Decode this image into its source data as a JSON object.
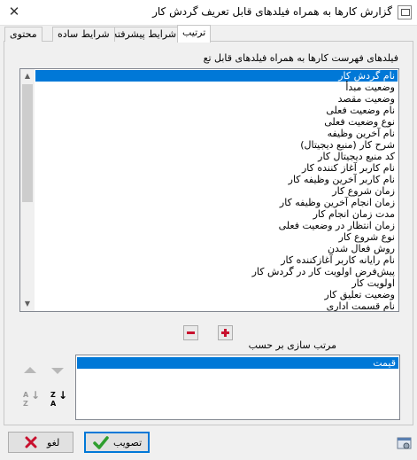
{
  "window": {
    "title": "گزارش کارها به همراه فیلدهای قابل تعریف گردش کار",
    "close_glyph": "✕"
  },
  "tabs": [
    {
      "label": "ترتیب",
      "active": true
    },
    {
      "label": "شرایط پیشرفته",
      "active": false
    },
    {
      "label": "شرایط ساده",
      "active": false
    },
    {
      "label": "محتوی",
      "active": false
    }
  ],
  "fields_section": {
    "label": "فیلدهای فهرست کارها به همراه فیلدهای قابل تع",
    "items": [
      "نام گردش کار",
      "وضعیت مبدأ",
      "وضعیت مقصد",
      "نام وضعیت فعلی",
      "نوع وضعیت فعلی",
      "نام آخرین وظیفه",
      "شرح کار (منبع دیجیتال)",
      "کد منبع دیجیتال کار",
      "نام کاربر آغاز کننده کار",
      "نام کاربر آخرین وظیفه کار",
      "زمان شروع کار",
      "زمان انجام آخرین وظیفه کار",
      "مدت زمان انجام کار",
      "زمان انتظار در وضعیت فعلی",
      "نوع شروع کار",
      "روش فعال شدن",
      "نام رایانه کاربر آغازکننده کار",
      "پیش‌فرض اولویت کار در گردش کار",
      "اولویت کار",
      "وضعیت تعلیق کار",
      "نام قسمت اداری"
    ],
    "selected_index": 0
  },
  "sort_section": {
    "label": "مرتب سازی بر حسب",
    "items": [
      "قیمت"
    ],
    "az_top": "A",
    "az_bottom": "Z",
    "za_top": "Z",
    "za_bottom": "A"
  },
  "buttons": {
    "ok": "تصویب",
    "cancel": "لغو"
  },
  "icons": {
    "remove": "minus-icon",
    "add": "plus-icon",
    "ok": "check-icon",
    "cancel": "x-icon"
  },
  "colors": {
    "selection": "#0078d7",
    "accent_red": "#c8102e",
    "check_green": "#2e9e2e"
  }
}
